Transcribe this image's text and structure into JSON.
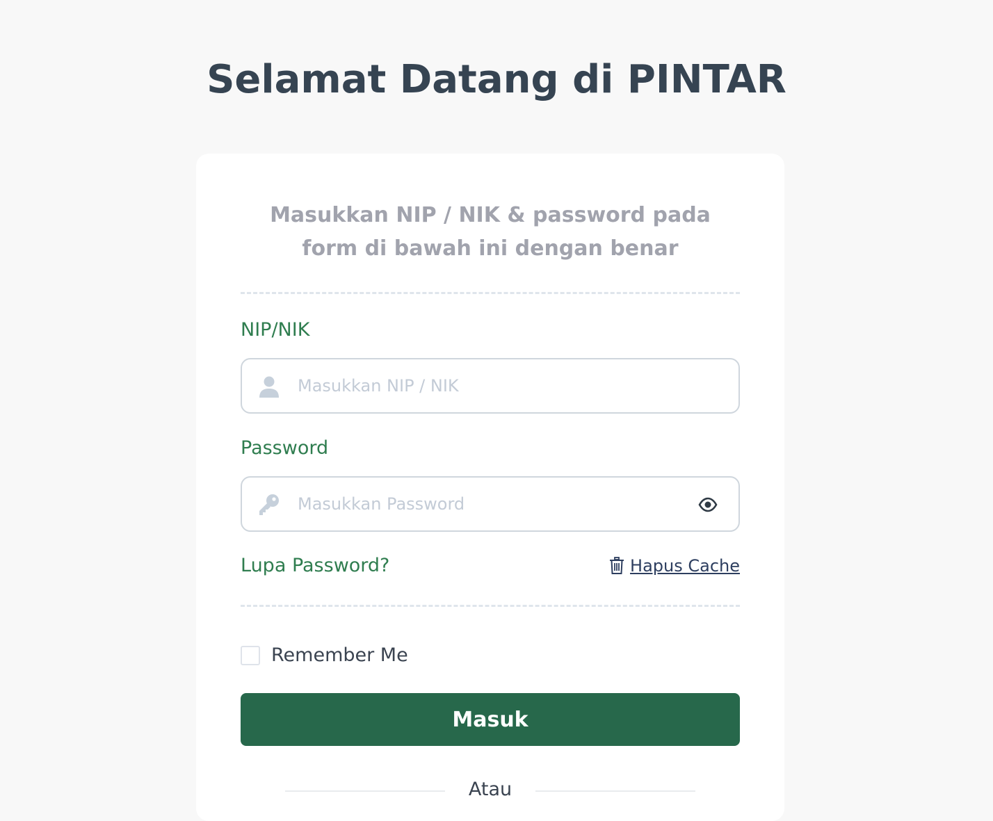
{
  "page": {
    "title": "Selamat Datang di PINTAR"
  },
  "login_card": {
    "subtitle": "Masukkan NIP / NIK & password pada form di bawah ini dengan benar",
    "nip": {
      "label": "NIP/NIK",
      "placeholder": "Masukkan NIP / NIK",
      "value": "",
      "icon": "user-icon"
    },
    "password": {
      "label": "Password",
      "placeholder": "Masukkan Password",
      "value": "",
      "icon": "key-icon",
      "toggle_icon": "eye-icon"
    },
    "forgot_password_label": "Lupa Password?",
    "clear_cache_label": "Hapus Cache",
    "remember_me_label": "Remember Me",
    "remember_me_checked": false,
    "submit_label": "Masuk",
    "separator_label": "Atau"
  },
  "colors": {
    "background": "#f8f8f8",
    "title": "#364452",
    "accent_green": "#2f7d4f",
    "button_green": "#27684b",
    "muted": "#a1a3ad",
    "link_blue": "#2d3e5f"
  }
}
